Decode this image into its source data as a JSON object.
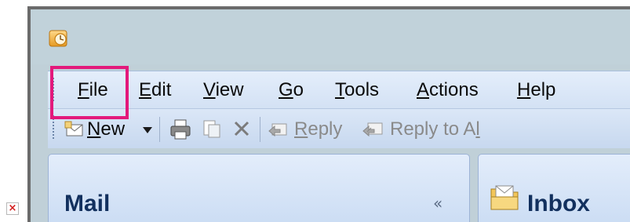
{
  "app": {
    "icon": "outlook-clock-icon"
  },
  "menu_bar": {
    "items": [
      {
        "mnemonic": "F",
        "rest": "ile",
        "name": "File"
      },
      {
        "mnemonic": "E",
        "rest": "dit",
        "name": "Edit"
      },
      {
        "mnemonic": "V",
        "rest": "iew",
        "name": "View"
      },
      {
        "mnemonic": "G",
        "rest": "o",
        "name": "Go"
      },
      {
        "mnemonic": "T",
        "rest": "ools",
        "name": "Tools"
      },
      {
        "mnemonic": "A",
        "rest": "ctions",
        "name": "Actions"
      },
      {
        "mnemonic": "H",
        "rest": "elp",
        "name": "Help"
      }
    ],
    "highlighted": "File",
    "highlight_color": "#e3197b"
  },
  "toolbar": {
    "new": {
      "mnemonic": "N",
      "rest": "ew"
    },
    "reply": {
      "mnemonic": "R",
      "rest": "eply",
      "enabled": false
    },
    "reply_all": {
      "prefix": "Reply to A",
      "mnemonic": "l",
      "rest": "l",
      "enabled": false
    },
    "icons": [
      "new-message-icon",
      "dropdown-arrow-icon",
      "print-icon",
      "move-to-folder-icon",
      "delete-icon",
      "reply-icon",
      "reply-all-icon"
    ]
  },
  "navigation_pane": {
    "title": "Mail",
    "collapse_glyph": "«"
  },
  "content_pane": {
    "title": "Inbox",
    "icon": "inbox-folder-icon"
  },
  "colors": {
    "window_bg": "#c0d0d8",
    "menu_bar_bg": "#e4eefb",
    "pane_header_text": "#12305e",
    "disabled_text": "#8a8a8a"
  }
}
